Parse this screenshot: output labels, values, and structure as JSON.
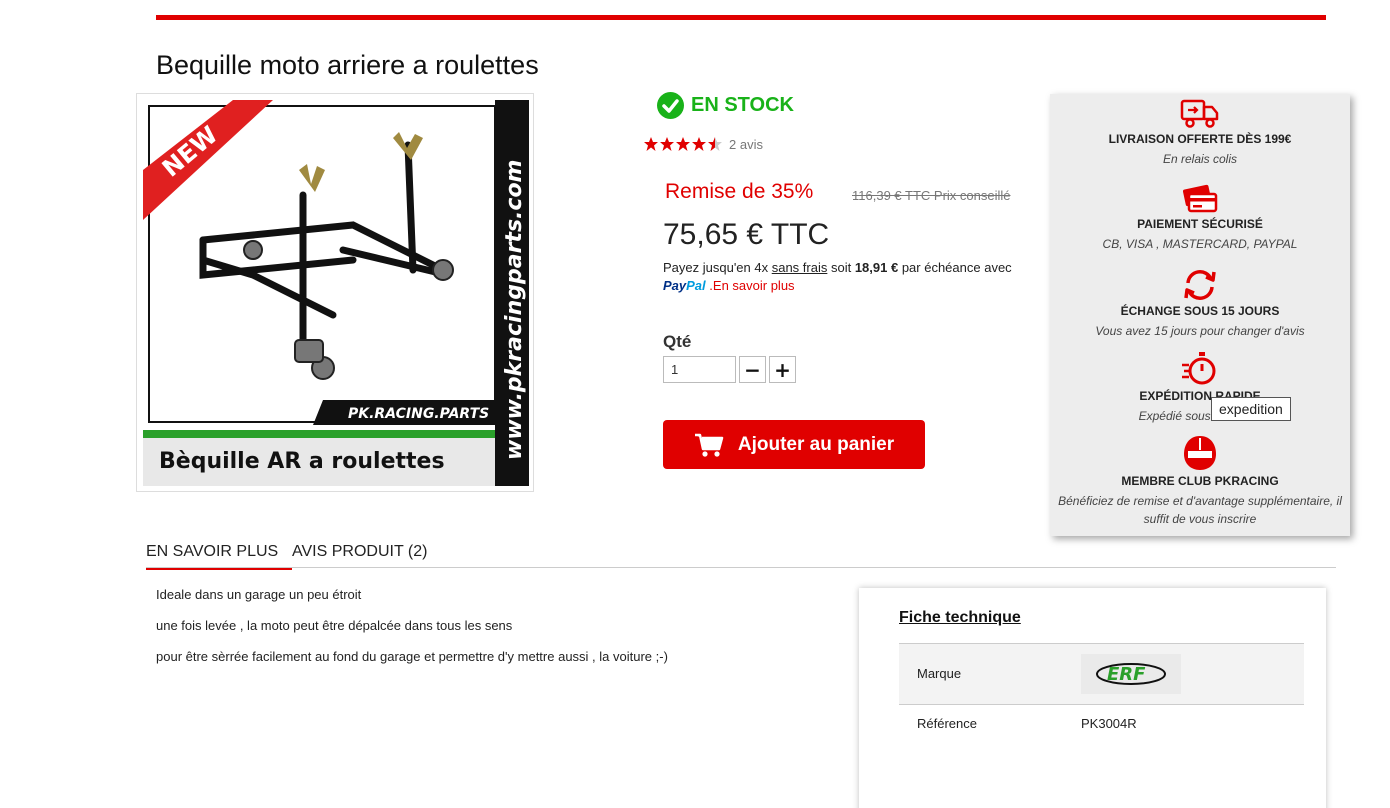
{
  "product": {
    "title": "Bequille moto arriere a roulettes",
    "image_text": {
      "badge": "NEW",
      "vertical_url": "www.pkracingparts.com",
      "brand_logo": "PK.RACING.PARTS",
      "caption": "Bèquille AR a roulettes"
    },
    "stock_label": "EN STOCK",
    "rating_stars": 4.5,
    "reviews_label": "2 avis",
    "discount_label": "Remise de 35%",
    "old_price_label": "116,39 € TTC Prix conseillé",
    "price_label": "75,65 € TTC",
    "paypal": {
      "text_1": "Payez jusqu'en 4x ",
      "link_sans_frais": "sans frais",
      "text_2": " soit ",
      "installment": "18,91 €",
      "text_3": " par échéance avec",
      "logo_pay": "Pay",
      "logo_pal": "Pal",
      "more_link": ".En savoir plus"
    },
    "qty_label": "Qté",
    "qty_value": "1",
    "add_to_cart_label": "Ajouter au panier"
  },
  "reassurance": [
    {
      "icon": "delivery-truck-icon",
      "title": "LIVRAISON OFFERTE DÈS 199€",
      "sub": "En relais colis"
    },
    {
      "icon": "credit-card-icon",
      "title": "PAIEMENT SÉCURISÉ",
      "sub": "CB, VISA , MASTERCARD, PAYPAL"
    },
    {
      "icon": "exchange-arrows-icon",
      "title": "ÉCHANGE SOUS 15 JOURS",
      "sub": "Vous avez 15 jours pour changer d'avis"
    },
    {
      "icon": "fast-timer-icon",
      "title": "EXPÉDITION RAPIDE",
      "sub": "Expédié sous 24H/48H"
    },
    {
      "icon": "helmet-icon",
      "title": "MEMBRE CLUB PKRACING",
      "sub": "Bénéficiez de remise et d'avantage supplémentaire, il suffit de vous inscrire"
    }
  ],
  "tooltip": "expedition",
  "tabs": [
    {
      "label": "EN SAVOIR PLUS"
    },
    {
      "label": "AVIS PRODUIT (2)"
    }
  ],
  "description": [
    "Ideale dans un garage un peu étroit",
    " une fois levée , la moto peut être dépalcée dans tous les sens",
    " pour être sèrrée facilement au fond du garage et permettre d'y mettre aussi , la voiture ;-)"
  ],
  "datasheet": {
    "title": "Fiche technique",
    "rows": [
      {
        "key": "Marque",
        "value": "",
        "logo_text": "ERF"
      },
      {
        "key": "Référence",
        "value": "PK3004R"
      }
    ]
  },
  "colors": {
    "accent": "#e00000",
    "stock": "#19b219",
    "panel": "#ededed"
  }
}
